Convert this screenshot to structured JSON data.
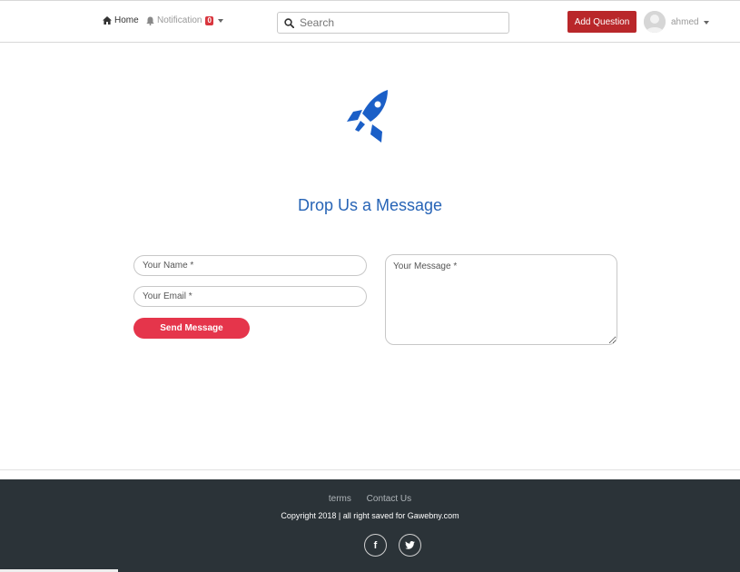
{
  "navbar": {
    "home_label": "Home",
    "notification_label": "Notification",
    "notification_count": "0",
    "search_placeholder": "Search",
    "add_question_label": "Add Question",
    "username": "ahmed"
  },
  "main": {
    "title": "Drop Us a Message",
    "name_placeholder": "Your Name *",
    "email_placeholder": "Your Email *",
    "message_placeholder": "Your Message *",
    "send_label": "Send Message"
  },
  "footer": {
    "links": [
      "terms",
      "Contact Us"
    ],
    "copyright": "Copyright 2018 | all right saved for Gawebny.com",
    "social": [
      "f",
      "twitter-icon"
    ]
  },
  "colors": {
    "accent_blue": "#2764b6",
    "add_question_red": "#b9272a",
    "send_button_red": "#e5354b",
    "footer_bg": "#2b3338"
  }
}
